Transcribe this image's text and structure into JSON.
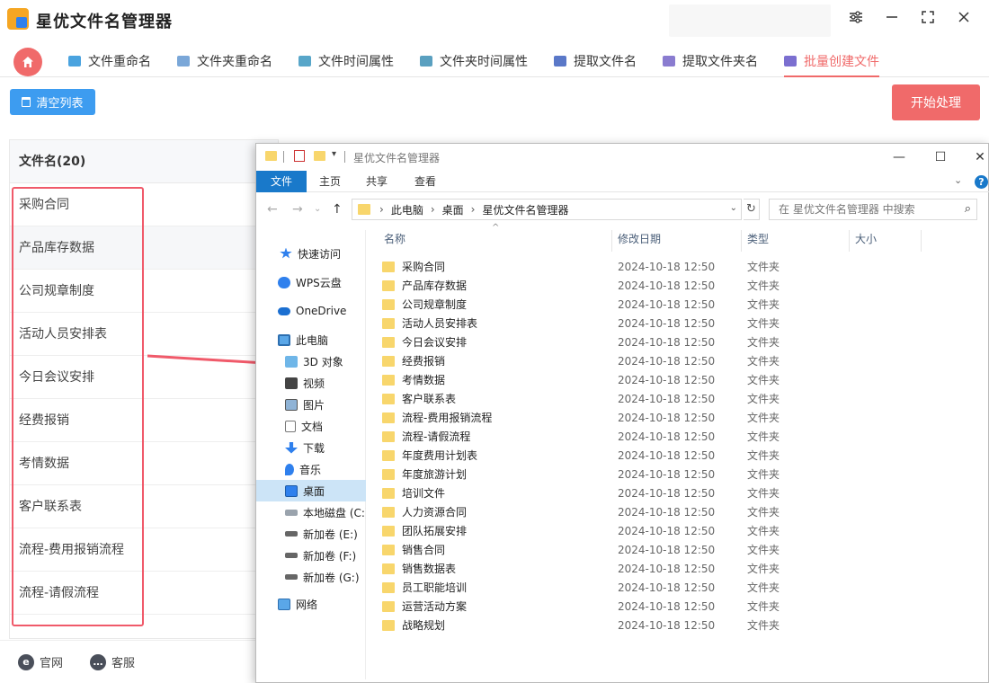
{
  "app": {
    "title": "星优文件名管理器",
    "colors": {
      "accent": "#f06a6a",
      "primary": "#3d9cf0"
    }
  },
  "tabs": [
    {
      "label": "文件重命名",
      "color": "#4aa3df"
    },
    {
      "label": "文件夹重命名",
      "color": "#7aa7d8"
    },
    {
      "label": "文件时间属性",
      "color": "#58a6c9"
    },
    {
      "label": "文件夹时间属性",
      "color": "#5aa0c0"
    },
    {
      "label": "提取文件名",
      "color": "#5a78c8"
    },
    {
      "label": "提取文件夹名",
      "color": "#8a7cd0"
    },
    {
      "label": "批量创建文件",
      "color": "#7b6fd0"
    }
  ],
  "toolbar": {
    "clear_label": "清空列表",
    "start_label": "开始处理"
  },
  "list": {
    "header": "文件名(20)",
    "rows": [
      "采购合同",
      "产品库存数据",
      "公司规章制度",
      "活动人员安排表",
      "今日会议安排",
      "经费报销",
      "考情数据",
      "客户联系表",
      "流程-费用报销流程",
      "流程-请假流程"
    ]
  },
  "footer": {
    "site": "官网",
    "service": "客服"
  },
  "explorer": {
    "title": "星优文件名管理器",
    "ribbon": [
      "文件",
      "主页",
      "共享",
      "查看"
    ],
    "address": [
      "此电脑",
      "桌面",
      "星优文件名管理器"
    ],
    "search_placeholder": "在 星优文件名管理器 中搜索",
    "nav": [
      {
        "label": "快速访问",
        "icon": "star-icon"
      },
      {
        "label": "WPS云盘",
        "icon": "cloud-icon"
      },
      {
        "label": "OneDrive",
        "icon": "onedrive-icon"
      },
      {
        "label": "此电脑",
        "icon": "computer-icon"
      },
      {
        "label": "3D 对象",
        "icon": "cube-icon"
      },
      {
        "label": "视频",
        "icon": "video-icon"
      },
      {
        "label": "图片",
        "icon": "picture-icon"
      },
      {
        "label": "文档",
        "icon": "document-icon"
      },
      {
        "label": "下载",
        "icon": "download-icon"
      },
      {
        "label": "音乐",
        "icon": "music-icon"
      },
      {
        "label": "桌面",
        "icon": "desktop-icon"
      },
      {
        "label": "本地磁盘 (C:)",
        "icon": "drive-icon"
      },
      {
        "label": "新加卷 (E:)",
        "icon": "drive-icon"
      },
      {
        "label": "新加卷 (F:)",
        "icon": "drive-icon"
      },
      {
        "label": "新加卷 (G:)",
        "icon": "drive-icon"
      },
      {
        "label": "网络",
        "icon": "network-icon"
      }
    ],
    "columns": {
      "name": "名称",
      "date": "修改日期",
      "type": "类型",
      "size": "大小"
    },
    "files": [
      {
        "name": "采购合同",
        "date": "2024-10-18 12:50",
        "type": "文件夹"
      },
      {
        "name": "产品库存数据",
        "date": "2024-10-18 12:50",
        "type": "文件夹"
      },
      {
        "name": "公司规章制度",
        "date": "2024-10-18 12:50",
        "type": "文件夹"
      },
      {
        "name": "活动人员安排表",
        "date": "2024-10-18 12:50",
        "type": "文件夹"
      },
      {
        "name": "今日会议安排",
        "date": "2024-10-18 12:50",
        "type": "文件夹"
      },
      {
        "name": "经费报销",
        "date": "2024-10-18 12:50",
        "type": "文件夹"
      },
      {
        "name": "考情数据",
        "date": "2024-10-18 12:50",
        "type": "文件夹"
      },
      {
        "name": "客户联系表",
        "date": "2024-10-18 12:50",
        "type": "文件夹"
      },
      {
        "name": "流程-费用报销流程",
        "date": "2024-10-18 12:50",
        "type": "文件夹"
      },
      {
        "name": "流程-请假流程",
        "date": "2024-10-18 12:50",
        "type": "文件夹"
      },
      {
        "name": "年度费用计划表",
        "date": "2024-10-18 12:50",
        "type": "文件夹"
      },
      {
        "name": "年度旅游计划",
        "date": "2024-10-18 12:50",
        "type": "文件夹"
      },
      {
        "name": "培训文件",
        "date": "2024-10-18 12:50",
        "type": "文件夹"
      },
      {
        "name": "人力资源合同",
        "date": "2024-10-18 12:50",
        "type": "文件夹"
      },
      {
        "name": "团队拓展安排",
        "date": "2024-10-18 12:50",
        "type": "文件夹"
      },
      {
        "name": "销售合同",
        "date": "2024-10-18 12:50",
        "type": "文件夹"
      },
      {
        "name": "销售数据表",
        "date": "2024-10-18 12:50",
        "type": "文件夹"
      },
      {
        "name": "员工职能培训",
        "date": "2024-10-18 12:50",
        "type": "文件夹"
      },
      {
        "name": "运营活动方案",
        "date": "2024-10-18 12:50",
        "type": "文件夹"
      },
      {
        "name": "战略规划",
        "date": "2024-10-18 12:50",
        "type": "文件夹"
      }
    ]
  }
}
